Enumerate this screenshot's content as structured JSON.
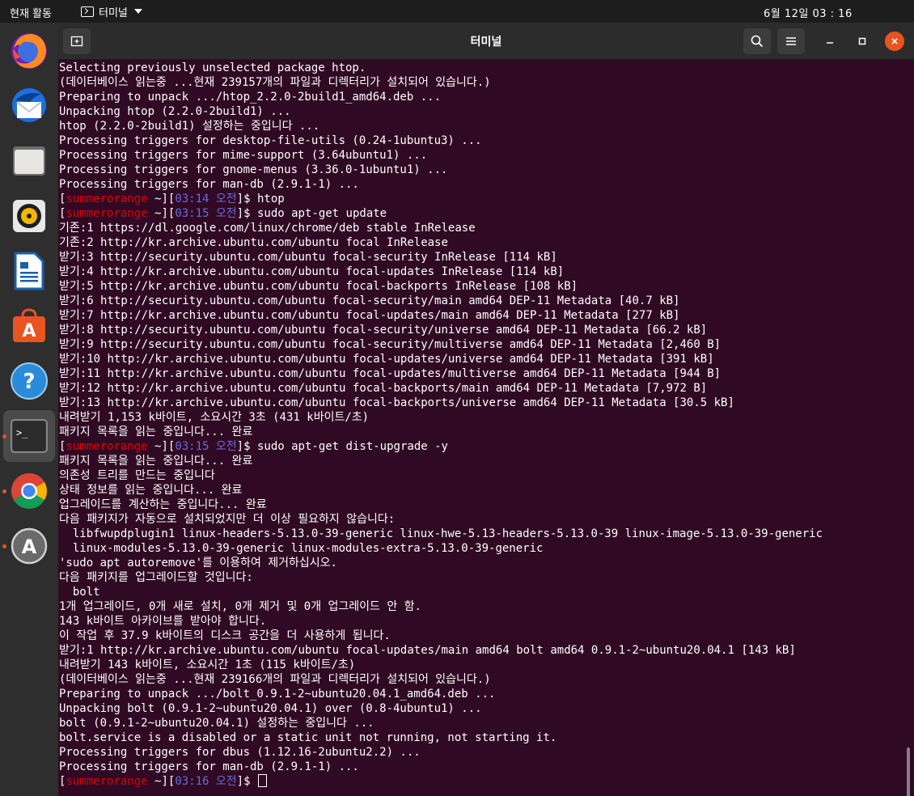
{
  "topbar": {
    "activities": "현재 활동",
    "app_menu": "터미널",
    "clock": "6월 12일  03 : 16"
  },
  "dock": {
    "items": [
      {
        "name": "firefox",
        "icon": "firefox-icon"
      },
      {
        "name": "thunderbird",
        "icon": "thunderbird-icon"
      },
      {
        "name": "files",
        "icon": "files-icon"
      },
      {
        "name": "rhythmbox",
        "icon": "rhythmbox-icon"
      },
      {
        "name": "libreoffice-writer",
        "icon": "writer-icon"
      },
      {
        "name": "ubuntu-software",
        "icon": "software-icon"
      },
      {
        "name": "help",
        "icon": "help-icon"
      },
      {
        "name": "terminal",
        "icon": "terminal-icon"
      },
      {
        "name": "chrome",
        "icon": "chrome-icon"
      },
      {
        "name": "software-updater",
        "icon": "updater-icon"
      }
    ]
  },
  "window": {
    "title": "터미널"
  },
  "colors": {
    "terminal_bg": "#300a24",
    "prompt_user": "#e00000",
    "prompt_time": "#6b6bd6",
    "close_button": "#e95420"
  },
  "terminal": {
    "prompt_user": "summerorange",
    "prompt_path": "~",
    "lines": [
      {
        "text": "Selecting previously unselected package htop."
      },
      {
        "text": "(데이터베이스 읽는중 ...현재 239157개의 파일과 디렉터리가 설치되어 있습니다.)"
      },
      {
        "text": "Preparing to unpack .../htop_2.2.0-2build1_amd64.deb ..."
      },
      {
        "text": "Unpacking htop (2.2.0-2build1) ..."
      },
      {
        "text": "htop (2.2.0-2build1) 설정하는 중입니다 ..."
      },
      {
        "text": "Processing triggers for desktop-file-utils (0.24-1ubuntu3) ..."
      },
      {
        "text": "Processing triggers for mime-support (3.64ubuntu1) ..."
      },
      {
        "text": "Processing triggers for gnome-menus (3.36.0-1ubuntu1) ..."
      },
      {
        "text": "Processing triggers for man-db (2.9.1-1) ..."
      },
      {
        "prompt": true,
        "time": "03:14 오전",
        "cmd": "htop"
      },
      {
        "prompt": true,
        "time": "03:15 오전",
        "cmd": "sudo apt-get update"
      },
      {
        "text": "기존:1 https://dl.google.com/linux/chrome/deb stable InRelease"
      },
      {
        "text": "기존:2 http://kr.archive.ubuntu.com/ubuntu focal InRelease"
      },
      {
        "text": "받기:3 http://security.ubuntu.com/ubuntu focal-security InRelease [114 kB]"
      },
      {
        "text": "받기:4 http://kr.archive.ubuntu.com/ubuntu focal-updates InRelease [114 kB]"
      },
      {
        "text": "받기:5 http://kr.archive.ubuntu.com/ubuntu focal-backports InRelease [108 kB]"
      },
      {
        "text": "받기:6 http://security.ubuntu.com/ubuntu focal-security/main amd64 DEP-11 Metadata [40.7 kB]"
      },
      {
        "text": "받기:7 http://kr.archive.ubuntu.com/ubuntu focal-updates/main amd64 DEP-11 Metadata [277 kB]"
      },
      {
        "text": "받기:8 http://security.ubuntu.com/ubuntu focal-security/universe amd64 DEP-11 Metadata [66.2 kB]"
      },
      {
        "text": "받기:9 http://security.ubuntu.com/ubuntu focal-security/multiverse amd64 DEP-11 Metadata [2,460 B]"
      },
      {
        "text": "받기:10 http://kr.archive.ubuntu.com/ubuntu focal-updates/universe amd64 DEP-11 Metadata [391 kB]"
      },
      {
        "text": "받기:11 http://kr.archive.ubuntu.com/ubuntu focal-updates/multiverse amd64 DEP-11 Metadata [944 B]"
      },
      {
        "text": "받기:12 http://kr.archive.ubuntu.com/ubuntu focal-backports/main amd64 DEP-11 Metadata [7,972 B]"
      },
      {
        "text": "받기:13 http://kr.archive.ubuntu.com/ubuntu focal-backports/universe amd64 DEP-11 Metadata [30.5 kB]"
      },
      {
        "text": "내려받기 1,153 k바이트, 소요시간 3초 (431 k바이트/초)"
      },
      {
        "text": "패키지 목록을 읽는 중입니다... 완료"
      },
      {
        "prompt": true,
        "time": "03:15 오전",
        "cmd": "sudo apt-get dist-upgrade -y"
      },
      {
        "text": "패키지 목록을 읽는 중입니다... 완료"
      },
      {
        "text": "의존성 트리를 만드는 중입니다"
      },
      {
        "text": "상태 정보를 읽는 중입니다... 완료"
      },
      {
        "text": "업그레이드를 계산하는 중입니다... 완료"
      },
      {
        "text": "다음 패키지가 자동으로 설치되었지만 더 이상 필요하지 않습니다:"
      },
      {
        "text": "  libfwupdplugin1 linux-headers-5.13.0-39-generic linux-hwe-5.13-headers-5.13.0-39 linux-image-5.13.0-39-generic"
      },
      {
        "text": "  linux-modules-5.13.0-39-generic linux-modules-extra-5.13.0-39-generic"
      },
      {
        "text": "'sudo apt autoremove'를 이용하여 제거하십시오."
      },
      {
        "text": "다음 패키지를 업그레이드할 것입니다:"
      },
      {
        "text": "  bolt"
      },
      {
        "text": "1개 업그레이드, 0개 새로 설치, 0개 제거 및 0개 업그레이드 안 함."
      },
      {
        "text": "143 k바이트 아카이브를 받아야 합니다."
      },
      {
        "text": "이 작업 후 37.9 k바이트의 디스크 공간을 더 사용하게 됩니다."
      },
      {
        "text": "받기:1 http://kr.archive.ubuntu.com/ubuntu focal-updates/main amd64 bolt amd64 0.9.1-2~ubuntu20.04.1 [143 kB]"
      },
      {
        "text": "내려받기 143 k바이트, 소요시간 1초 (115 k바이트/초)"
      },
      {
        "text": "(데이터베이스 읽는중 ...현재 239166개의 파일과 디렉터리가 설치되어 있습니다.)"
      },
      {
        "text": "Preparing to unpack .../bolt_0.9.1-2~ubuntu20.04.1_amd64.deb ..."
      },
      {
        "text": "Unpacking bolt (0.9.1-2~ubuntu20.04.1) over (0.8-4ubuntu1) ..."
      },
      {
        "text": "bolt (0.9.1-2~ubuntu20.04.1) 설정하는 중입니다 ..."
      },
      {
        "text": "bolt.service is a disabled or a static unit not running, not starting it."
      },
      {
        "text": "Processing triggers for dbus (1.12.16-2ubuntu2.2) ..."
      },
      {
        "text": "Processing triggers for man-db (2.9.1-1) ..."
      },
      {
        "prompt": true,
        "time": "03:16 오전",
        "cmd": "",
        "cursor": true
      }
    ]
  }
}
